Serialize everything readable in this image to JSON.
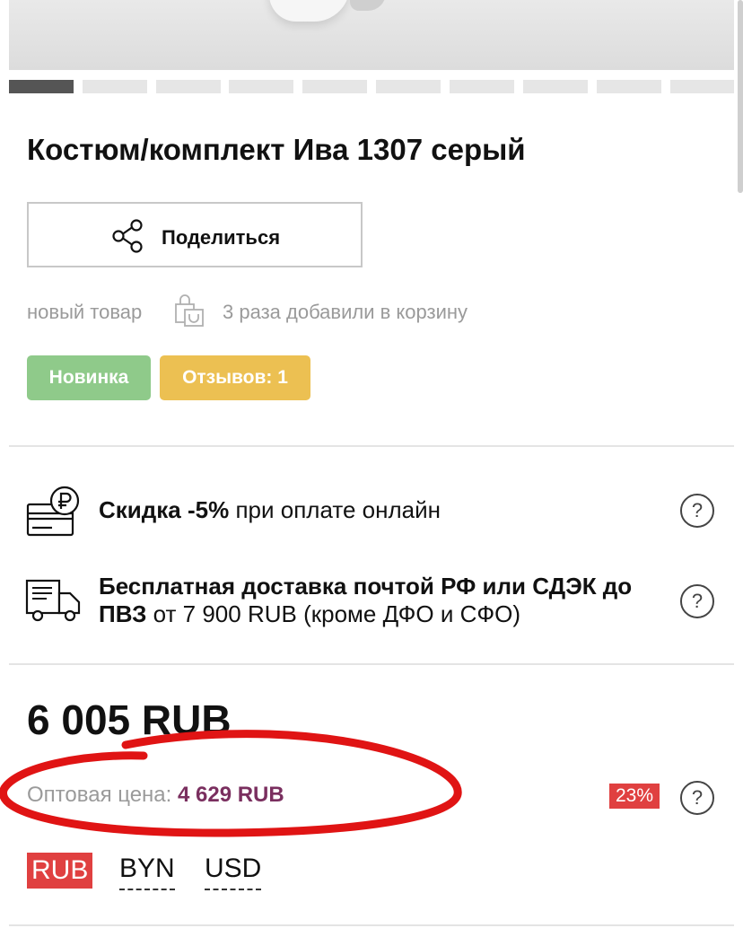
{
  "product": {
    "title": "Костюм/комплект Ива 1307 серый",
    "share_label": "Поделиться",
    "status_text": "новый товар",
    "added_text": "3 раза добавили в корзину"
  },
  "gallery": {
    "slides_total": 10,
    "active_index": 0
  },
  "badges": {
    "new_label": "Новинка",
    "reviews_label": "Отзывов: 1",
    "new_color": "#8fca8a",
    "reviews_color": "#ecc052"
  },
  "promos": {
    "discount_bold": "Скидка -5%",
    "discount_rest": " при оплате онлайн",
    "delivery_bold": "Бесплатная доставка почтой РФ или СДЭК до ПВЗ",
    "delivery_rest": " от 7 900 RUB (кроме ДФО и СФО)",
    "help_glyph": "?"
  },
  "pricing": {
    "price": "6 005 RUB",
    "wholesale_label": "Оптовая цена: ",
    "wholesale_value": "4 629 RUB",
    "discount_badge": "23%",
    "accent_color": "#e04040"
  },
  "currencies": [
    "RUB",
    "BYN",
    "USD"
  ],
  "icons": {
    "share": "share-icon",
    "bag": "shopping-bag-icon",
    "card": "ruble-card-icon",
    "truck": "delivery-truck-icon",
    "help": "help-icon"
  }
}
